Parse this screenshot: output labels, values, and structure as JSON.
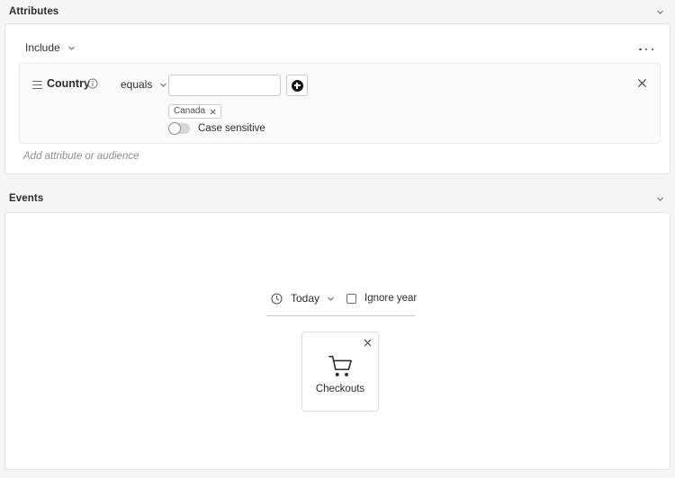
{
  "sections": {
    "attributes": {
      "title": "Attributes",
      "collapse_icon": "chevron-down-icon",
      "include_label": "Include",
      "overflow_menu": "more-options-icon",
      "add_placeholder": "Add attribute or audience",
      "condition": {
        "drag_handle": "drag-handle-icon",
        "attribute_name": "Country",
        "info_icon": "info-icon",
        "operator": "equals",
        "value_input": "",
        "value_placeholder": "",
        "add_value_icon": "add-circle-icon",
        "tags": [
          {
            "label": "Canada",
            "remove_icon": "close-icon"
          }
        ],
        "case_sensitive_label": "Case sensitive",
        "case_sensitive_on": false,
        "remove_icon": "close-icon"
      }
    },
    "events": {
      "title": "Events",
      "collapse_icon": "chevron-down-icon",
      "timeframe": {
        "clock_icon": "clock-icon",
        "label": "Today",
        "chevron_icon": "chevron-down-icon",
        "ignore_year_label": "Ignore year",
        "ignore_year_checked": false
      },
      "event_cards": [
        {
          "icon": "shopping-cart-icon",
          "label": "Checkouts",
          "remove_icon": "close-icon"
        }
      ]
    }
  },
  "colors": {
    "page_background": "#f5f5f5",
    "card_background": "#ffffff",
    "condition_background": "#fafafa",
    "border": "#e3e3e3",
    "text_primary": "#2c2c2c",
    "text_muted": "#8d8d8d",
    "accent_dark": "#161616"
  }
}
